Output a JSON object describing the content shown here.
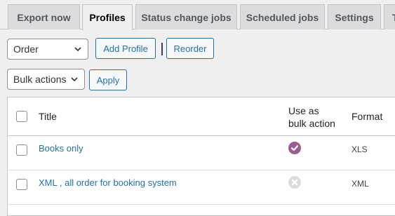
{
  "tabs": [
    {
      "label": "Export now",
      "active": false
    },
    {
      "label": "Profiles",
      "active": true
    },
    {
      "label": "Status change jobs",
      "active": false
    },
    {
      "label": "Scheduled jobs",
      "active": false
    },
    {
      "label": "Settings",
      "active": false
    },
    {
      "label": "T",
      "active": false
    }
  ],
  "toolbar": {
    "type_select_value": "Order",
    "add_profile_label": "Add Profile",
    "reorder_label": "Reorder",
    "bulk_select_value": "Bulk actions",
    "apply_label": "Apply"
  },
  "table": {
    "columns": {
      "title": "Title",
      "bulk_line1": "Use as",
      "bulk_line2": "bulk action",
      "format": "Format"
    },
    "rows": [
      {
        "title": "Books only",
        "bulk_action": true,
        "format": "XLS"
      },
      {
        "title": "XML , all order for booking system",
        "bulk_action": false,
        "format": "XML"
      }
    ]
  },
  "colors": {
    "accent": "#2271b1",
    "check_enabled": "#9b5c8f",
    "check_disabled": "#dcdcde"
  }
}
